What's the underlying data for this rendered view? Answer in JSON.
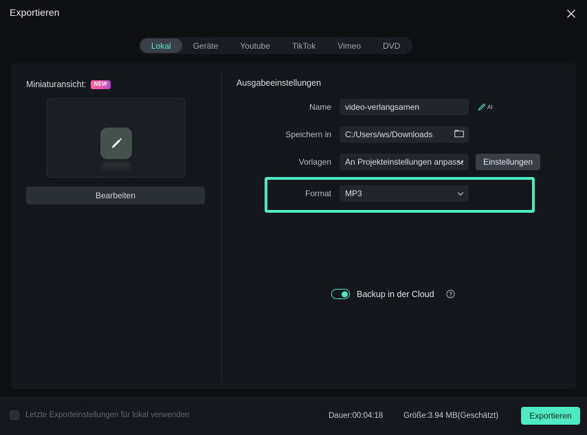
{
  "window": {
    "title": "Exportieren",
    "close_icon": "close-icon"
  },
  "tabs": [
    {
      "label": "Lokal",
      "active": true
    },
    {
      "label": "Geräte",
      "active": false
    },
    {
      "label": "Youtube",
      "active": false
    },
    {
      "label": "TikTok",
      "active": false
    },
    {
      "label": "Vimeo",
      "active": false
    },
    {
      "label": "DVD",
      "active": false
    }
  ],
  "thumbnail": {
    "label": "Miniaturansicht:",
    "badge": "NEW",
    "preview_icon": "pencil-edit-icon",
    "edit_button": "Bearbeiten"
  },
  "output": {
    "section_title": "Ausgabeeinstellungen",
    "name": {
      "label": "Name",
      "value": "video-verlangsamen",
      "placeholder": "Name",
      "ai_icon": "ai-pen-icon",
      "ai_text": "AI"
    },
    "save_in": {
      "label": "Speichern in",
      "value": "C:/Users/ws/Downloads",
      "placeholder": "Speichern in",
      "browse_icon": "folder-icon"
    },
    "templates": {
      "label": "Vorlagen",
      "value": "An Projekteinstellungen anpassen",
      "chevron_icon": "chevron-down-icon",
      "settings_button": "Einstellungen"
    },
    "format": {
      "label": "Format",
      "value": "MP3",
      "chevron_icon": "chevron-down-icon",
      "highlighted": true,
      "highlight_color": "#4fe9c3"
    }
  },
  "cloud_backup": {
    "label": "Backup in der Cloud",
    "enabled": true,
    "help_icon": "help-circle-icon",
    "toggle_color": "#4fe9c3"
  },
  "footer": {
    "remember_checkbox": {
      "label": "Letzte Exporteinstellungen für lokal verwenden",
      "checked": false
    },
    "duration": "Dauer:00:04:18",
    "size": "Größe:3.94 MB(Geschätzt)",
    "export_button": "Exportieren",
    "export_button_color": "#4fe9c3"
  }
}
